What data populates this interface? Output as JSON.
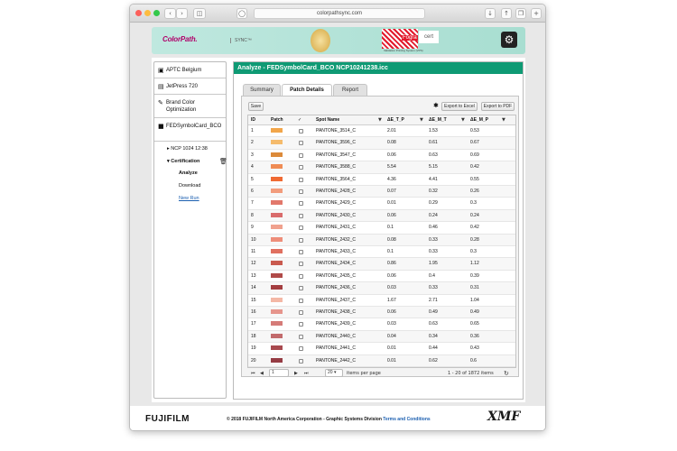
{
  "browser": {
    "url": "colorpathsync.com"
  },
  "header": {
    "logo": "ColorPath.",
    "sync_label": "SYNC™",
    "fogra_label": "Fogra",
    "cert_label": "cert",
    "fogra_sub": "Validation Printing System",
    "fogra_sub2": "(VPS)"
  },
  "sidebar": {
    "items": [
      {
        "icon": "building-icon",
        "label": "APTC Belgium"
      },
      {
        "icon": "printer-icon",
        "label": "JetPress 720"
      },
      {
        "icon": "paint-brush-icon",
        "label": "Brand Color Optimization"
      },
      {
        "icon": "folder-icon",
        "label": "FEDSymbolCard_BCO"
      }
    ],
    "sub": {
      "ncp": "NCP 1024 12:38",
      "certification": "Certification",
      "analyze": "Analyze",
      "download": "Download",
      "new_run": "New Run"
    }
  },
  "panel": {
    "title": "Analyze - FEDSymbolCard_BCO NCP10241238.icc",
    "tabs": [
      "Summary",
      "Patch Details",
      "Report"
    ],
    "active_tab": "Patch Details",
    "buttons": {
      "save": "Save",
      "excel": "Export to Excel",
      "pdf": "Export to PDF"
    }
  },
  "table": {
    "columns": [
      "ID",
      "Patch",
      "✓",
      "Spot Name",
      "ΔE_T_P",
      "ΔE_M_T",
      "ΔE_M_P"
    ],
    "rows": [
      {
        "id": "1",
        "color": "#f2a64a",
        "name": "PANTONE_3514_C",
        "a": "2.01",
        "b": "1.53",
        "c": "0.53"
      },
      {
        "id": "2",
        "color": "#f5bb6c",
        "name": "PANTONE_3596_C",
        "a": "0.08",
        "b": "0.61",
        "c": "0.67"
      },
      {
        "id": "3",
        "color": "#dc8a3a",
        "name": "PANTONE_3547_C",
        "a": "0.06",
        "b": "0.63",
        "c": "0.69"
      },
      {
        "id": "4",
        "color": "#ef8c55",
        "name": "PANTONE_3588_C",
        "a": "5.54",
        "b": "5.15",
        "c": "0.42"
      },
      {
        "id": "5",
        "color": "#f06a33",
        "name": "PANTONE_3564_C",
        "a": "4.36",
        "b": "4.41",
        "c": "0.55"
      },
      {
        "id": "6",
        "color": "#f29c7c",
        "name": "PANTONE_2428_C",
        "a": "0.07",
        "b": "0.32",
        "c": "0.26"
      },
      {
        "id": "7",
        "color": "#e2786b",
        "name": "PANTONE_2429_C",
        "a": "0.01",
        "b": "0.29",
        "c": "0.3"
      },
      {
        "id": "8",
        "color": "#d96b6b",
        "name": "PANTONE_2430_C",
        "a": "0.06",
        "b": "0.24",
        "c": "0.24"
      },
      {
        "id": "9",
        "color": "#f0a18e",
        "name": "PANTONE_2431_C",
        "a": "0.1",
        "b": "0.46",
        "c": "0.42"
      },
      {
        "id": "10",
        "color": "#ee8e7a",
        "name": "PANTONE_2432_C",
        "a": "0.08",
        "b": "0.33",
        "c": "0.28"
      },
      {
        "id": "11",
        "color": "#e07060",
        "name": "PANTONE_2433_C",
        "a": "0.1",
        "b": "0.33",
        "c": "0.3"
      },
      {
        "id": "12",
        "color": "#c95a4e",
        "name": "PANTONE_2434_C",
        "a": "0.86",
        "b": "1.95",
        "c": "1.12"
      },
      {
        "id": "13",
        "color": "#b04a48",
        "name": "PANTONE_2435_C",
        "a": "0.06",
        "b": "0.4",
        "c": "0.39"
      },
      {
        "id": "14",
        "color": "#a43e40",
        "name": "PANTONE_2436_C",
        "a": "0.03",
        "b": "0.33",
        "c": "0.31"
      },
      {
        "id": "15",
        "color": "#f4b8a6",
        "name": "PANTONE_2437_C",
        "a": "1.67",
        "b": "2.71",
        "c": "1.04"
      },
      {
        "id": "16",
        "color": "#e6958c",
        "name": "PANTONE_2438_C",
        "a": "0.06",
        "b": "0.49",
        "c": "0.49"
      },
      {
        "id": "17",
        "color": "#d57b78",
        "name": "PANTONE_2439_C",
        "a": "0.03",
        "b": "0.63",
        "c": "0.65"
      },
      {
        "id": "18",
        "color": "#c26a6c",
        "name": "PANTONE_2440_C",
        "a": "0.04",
        "b": "0.34",
        "c": "0.36"
      },
      {
        "id": "19",
        "color": "#a8494e",
        "name": "PANTONE_2441_C",
        "a": "0.01",
        "b": "0.44",
        "c": "0.43"
      },
      {
        "id": "20",
        "color": "#953b43",
        "name": "PANTONE_2442_C",
        "a": "0.01",
        "b": "0.62",
        "c": "0.6"
      }
    ]
  },
  "pager": {
    "page": "1",
    "per_page": "20",
    "per_page_label": "items per page",
    "range": "1 - 20 of 1872 items"
  },
  "footer": {
    "brand": "FUJIFILM",
    "copyright": "© 2018 FUJIFILM North America Corporation - Graphic Systems Division",
    "terms": "Terms and Conditions",
    "xmf": "XMF"
  },
  "colors": {
    "accent": "#0f9a74",
    "header_bg": "#bfe8df",
    "link": "#1b5fb0"
  }
}
